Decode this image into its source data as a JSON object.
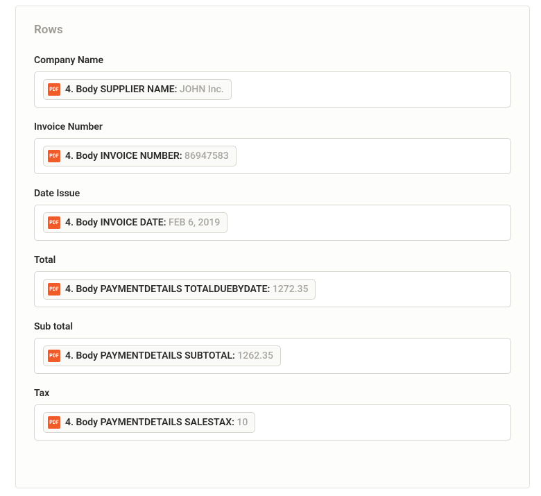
{
  "section": {
    "title": "Rows"
  },
  "badge": {
    "pdf": "PDF"
  },
  "fields": {
    "company_name": {
      "label": "Company Name",
      "chip_key": "4. Body SUPPLIER NAME:",
      "chip_value": "JOHN Inc."
    },
    "invoice_number": {
      "label": "Invoice Number",
      "chip_key": "4. Body INVOICE NUMBER:",
      "chip_value": "86947583"
    },
    "date_issue": {
      "label": "Date Issue",
      "chip_key": "4. Body INVOICE DATE:",
      "chip_value": "FEB 6, 2019"
    },
    "total": {
      "label": "Total",
      "chip_key": "4. Body PAYMENTDETAILS TOTALDUEBYDATE:",
      "chip_value": "1272.35"
    },
    "sub_total": {
      "label": "Sub total",
      "chip_key": "4. Body PAYMENTDETAILS SUBTOTAL:",
      "chip_value": "1262.35"
    },
    "tax": {
      "label": "Tax",
      "chip_key": "4. Body PAYMENTDETAILS SALESTAX:",
      "chip_value": "10"
    }
  }
}
